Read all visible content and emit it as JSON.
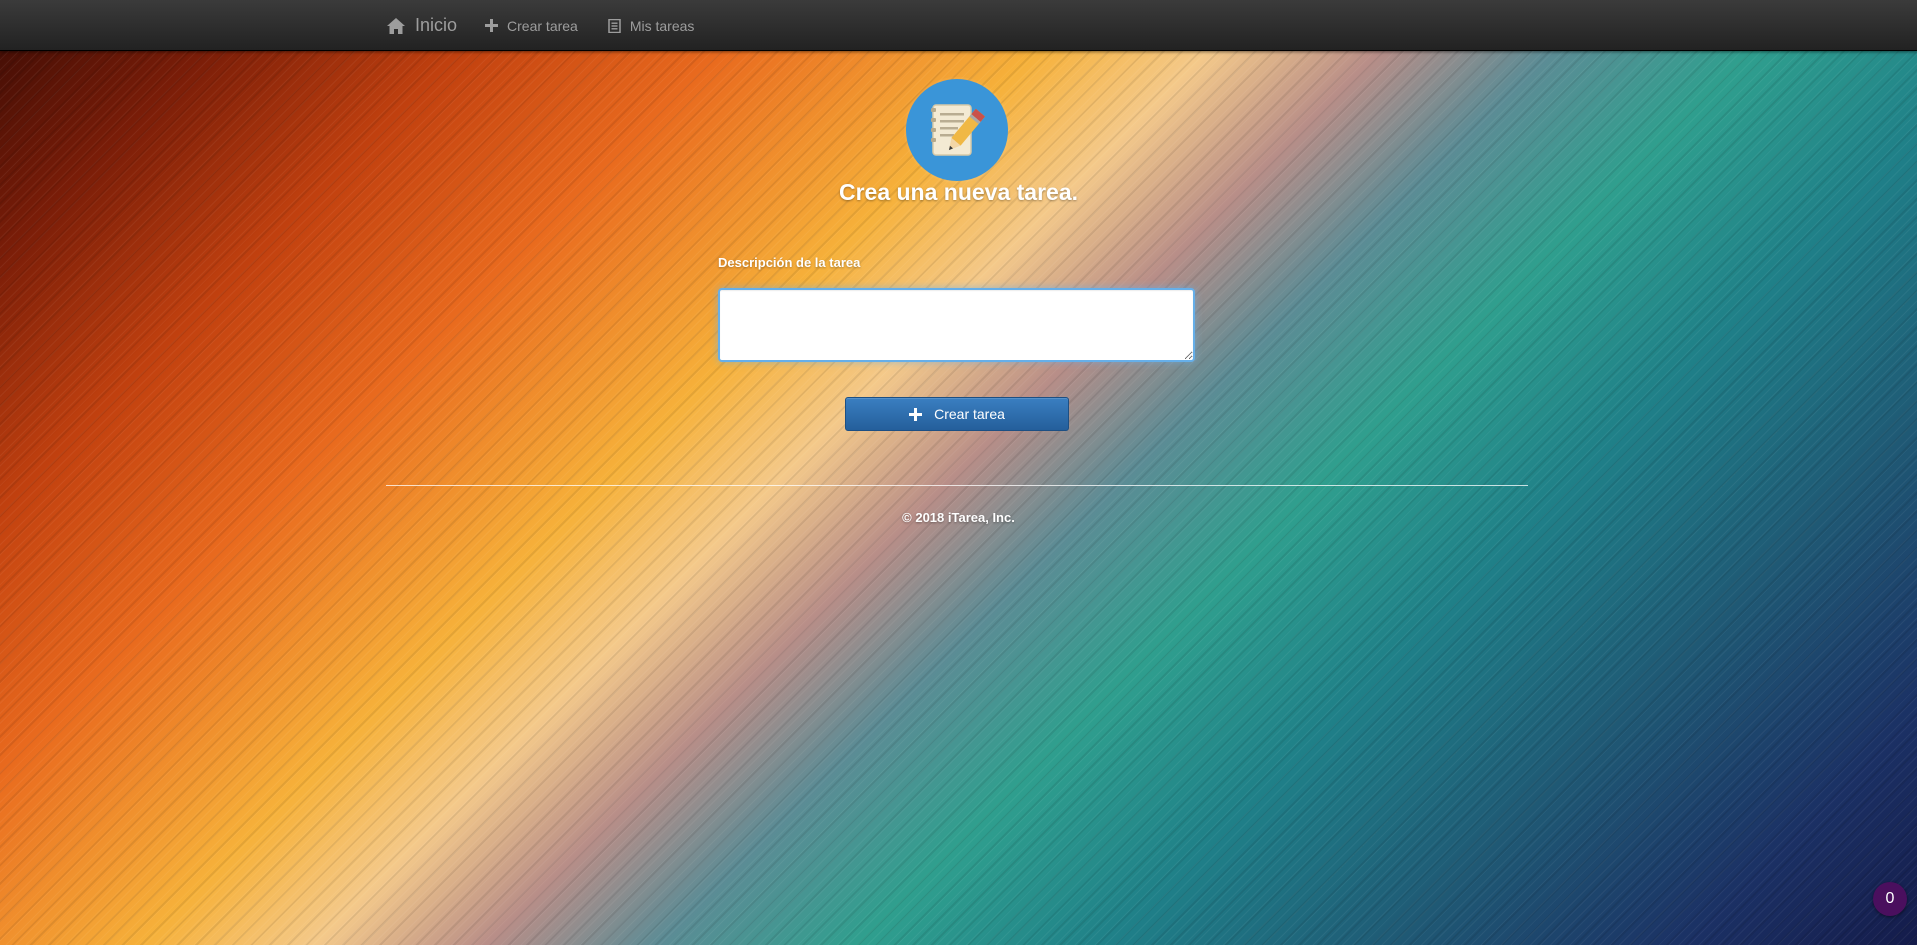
{
  "navbar": {
    "brand": {
      "label": "Inicio",
      "icon": "home-icon"
    },
    "links": [
      {
        "label": "Crear tarea",
        "icon": "plus-icon"
      },
      {
        "label": "Mis tareas",
        "icon": "list-icon"
      }
    ]
  },
  "main": {
    "logo_icon": "notepad-pencil-icon",
    "title": "Crea una nueva tarea.",
    "field_label": "Descripción de la tarea",
    "textarea_value": "",
    "submit_label": "Crear tarea"
  },
  "footer": {
    "text": "© 2018 iTarea, Inc."
  },
  "badge": {
    "count": "0"
  },
  "colors": {
    "navbar": "#222222",
    "primary_button": "#2d6ca8",
    "logo_circle": "#3a95d8",
    "badge": "#4a0f5e",
    "focus_border": "#66afe9"
  }
}
